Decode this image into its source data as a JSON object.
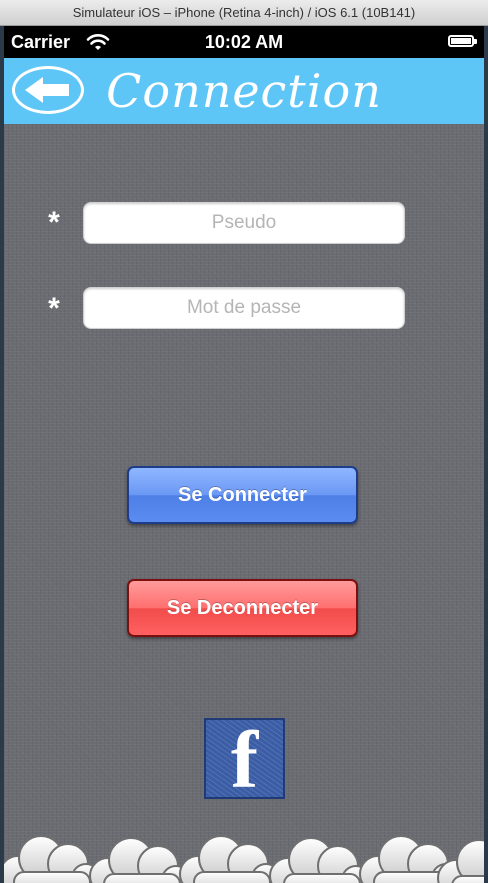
{
  "simulator": {
    "title": "Simulateur iOS – iPhone (Retina 4-inch) / iOS 6.1 (10B141)"
  },
  "status_bar": {
    "carrier": "Carrier",
    "time": "10:02 AM"
  },
  "nav": {
    "title": "Connection",
    "back_icon": "back-arrow-icon"
  },
  "form": {
    "required_marker": "*",
    "pseudo": {
      "placeholder": "Pseudo",
      "value": ""
    },
    "password": {
      "placeholder": "Mot de passe",
      "value": ""
    }
  },
  "buttons": {
    "connect": "Se Connecter",
    "disconnect": "Se Deconnecter"
  },
  "facebook": {
    "glyph": "f",
    "icon": "facebook-icon"
  },
  "colors": {
    "nav_bar": "#5ec5f7",
    "connect": "#5b8cf0",
    "disconnect": "#ff6060",
    "facebook": "#3a5da6"
  }
}
